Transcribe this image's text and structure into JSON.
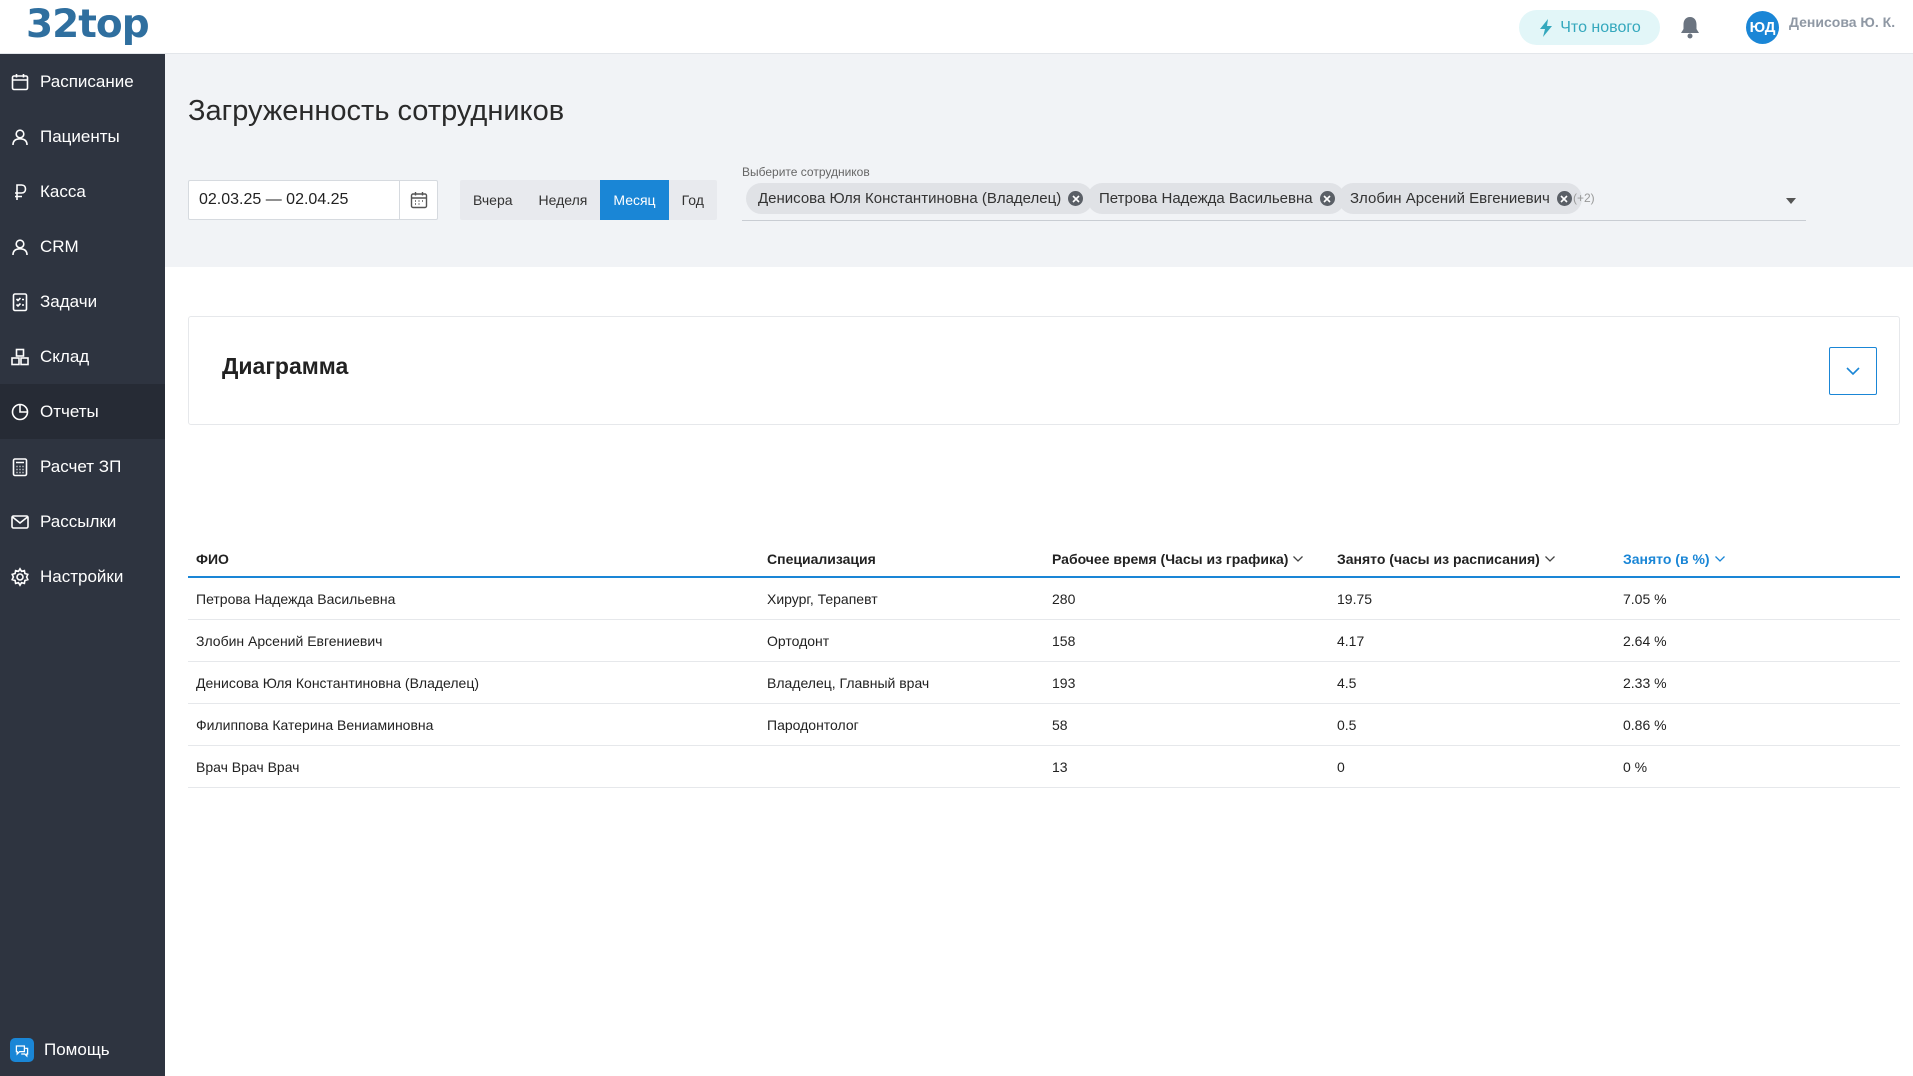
{
  "header": {
    "logo": "32top",
    "whats_new": "Что нового",
    "avatar_initials": "ЮД",
    "user_name": "Денисова Ю. К."
  },
  "sidebar": {
    "items": [
      {
        "label": "Расписание",
        "icon": "calendar-icon"
      },
      {
        "label": "Пациенты",
        "icon": "user-icon"
      },
      {
        "label": "Касса",
        "icon": "ruble-icon"
      },
      {
        "label": "CRM",
        "icon": "crm-icon"
      },
      {
        "label": "Задачи",
        "icon": "tasks-icon"
      },
      {
        "label": "Склад",
        "icon": "boxes-icon"
      },
      {
        "label": "Отчеты",
        "icon": "pie-chart-icon",
        "active": true
      },
      {
        "label": "Расчет ЗП",
        "icon": "calculator-icon"
      },
      {
        "label": "Рассылки",
        "icon": "mail-icon"
      },
      {
        "label": "Настройки",
        "icon": "gear-icon"
      }
    ],
    "help": "Помощь"
  },
  "page": {
    "title": "Загруженность сотрудников"
  },
  "filters": {
    "date_range": "02.03.25 — 02.04.25",
    "periods": [
      "Вчера",
      "Неделя",
      "Месяц",
      "Год"
    ],
    "active_period": "Месяц",
    "employees_label": "Выберите сотрудников",
    "employee_chips": [
      "Денисова Юля Константиновна (Владелец)",
      "Петрова Надежда Васильевна",
      "Злобин Арсений Евгениевич"
    ],
    "more_count": "(+2)"
  },
  "diagram": {
    "title": "Диаграмма"
  },
  "table": {
    "columns": [
      "ФИО",
      "Специализация",
      "Рабочее время (Часы из графика)",
      "Занято (часы из расписания)",
      "Занято (в %)"
    ],
    "rows": [
      [
        "Петрова Надежда Васильевна",
        "Хирург, Терапевт",
        "280",
        "19.75",
        "7.05 %"
      ],
      [
        "Злобин Арсений Евгениевич",
        "Ортодонт",
        "158",
        "4.17",
        "2.64 %"
      ],
      [
        "Денисова Юля Константиновна (Владелец)",
        "Владелец, Главный врач",
        "193",
        "4.5",
        "2.33 %"
      ],
      [
        "Филиппова Катерина Вениаминовна",
        "Пародонтолог",
        "58",
        "0.5",
        "0.86 %"
      ],
      [
        "Врач Врач Врач",
        "",
        "13",
        "0",
        "0 %"
      ]
    ]
  },
  "colors": {
    "accent": "#1a86d6",
    "sidebar_bg": "#2e3440",
    "logo": "#2f6f9f"
  }
}
